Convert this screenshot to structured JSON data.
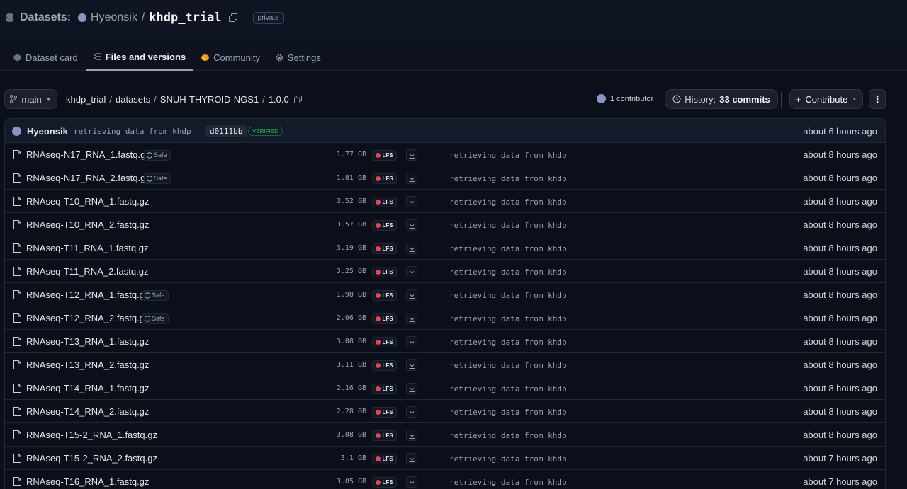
{
  "header": {
    "section_label": "Datasets:",
    "owner": "Hyeonsik",
    "separator": "/",
    "repo": "khdp_trial",
    "visibility": "private"
  },
  "tabs": [
    {
      "label": "Dataset card",
      "icon": "cube-icon"
    },
    {
      "label": "Files and versions",
      "icon": "files-icon",
      "active": true
    },
    {
      "label": "Community",
      "icon": "community-icon"
    },
    {
      "label": "Settings",
      "icon": "gear-icon"
    }
  ],
  "branch": {
    "name": "main",
    "path": [
      "khdp_trial",
      "datasets",
      "SNUH-THYROID-NGS1",
      "1.0.0"
    ],
    "path_sep": "/",
    "contributors": "1 contributor",
    "history_prefix": "History:",
    "history_count": "33 commits",
    "contribute_label": "Contribute",
    "more_label": "⋮"
  },
  "commit": {
    "author": "Hyeonsik",
    "message": "retrieving data from khdp",
    "hash": "d0111bb",
    "verified": "VERIFIED",
    "time": "about 6 hours ago"
  },
  "files": [
    {
      "name": "RNAseq-N17_RNA_1.fastq.gz",
      "safe": "Safe",
      "size": "1.77 GB",
      "lfs": "LFS",
      "message": "retrieving data from khdp",
      "time": "about 8 hours ago"
    },
    {
      "name": "RNAseq-N17_RNA_2.fastq.gz",
      "safe": "Safe",
      "size": "1.81 GB",
      "lfs": "LFS",
      "message": "retrieving data from khdp",
      "time": "about 8 hours ago"
    },
    {
      "name": "RNAseq-T10_RNA_1.fastq.gz",
      "safe": "",
      "size": "3.52 GB",
      "lfs": "LFS",
      "message": "retrieving data from khdp",
      "time": "about 8 hours ago"
    },
    {
      "name": "RNAseq-T10_RNA_2.fastq.gz",
      "safe": "",
      "size": "3.57 GB",
      "lfs": "LFS",
      "message": "retrieving data from khdp",
      "time": "about 8 hours ago"
    },
    {
      "name": "RNAseq-T11_RNA_1.fastq.gz",
      "safe": "",
      "size": "3.19 GB",
      "lfs": "LFS",
      "message": "retrieving data from khdp",
      "time": "about 8 hours ago"
    },
    {
      "name": "RNAseq-T11_RNA_2.fastq.gz",
      "safe": "",
      "size": "3.25 GB",
      "lfs": "LFS",
      "message": "retrieving data from khdp",
      "time": "about 8 hours ago"
    },
    {
      "name": "RNAseq-T12_RNA_1.fastq.gz",
      "safe": "Safe",
      "size": "1.98 GB",
      "lfs": "LFS",
      "message": "retrieving data from khdp",
      "time": "about 8 hours ago"
    },
    {
      "name": "RNAseq-T12_RNA_2.fastq.gz",
      "safe": "Safe",
      "size": "2.06 GB",
      "lfs": "LFS",
      "message": "retrieving data from khdp",
      "time": "about 8 hours ago"
    },
    {
      "name": "RNAseq-T13_RNA_1.fastq.gz",
      "safe": "",
      "size": "3.08 GB",
      "lfs": "LFS",
      "message": "retrieving data from khdp",
      "time": "about 8 hours ago"
    },
    {
      "name": "RNAseq-T13_RNA_2.fastq.gz",
      "safe": "",
      "size": "3.11 GB",
      "lfs": "LFS",
      "message": "retrieving data from khdp",
      "time": "about 8 hours ago"
    },
    {
      "name": "RNAseq-T14_RNA_1.fastq.gz",
      "safe": "",
      "size": "2.16 GB",
      "lfs": "LFS",
      "message": "retrieving data from khdp",
      "time": "about 8 hours ago"
    },
    {
      "name": "RNAseq-T14_RNA_2.fastq.gz",
      "safe": "",
      "size": "2.28 GB",
      "lfs": "LFS",
      "message": "retrieving data from khdp",
      "time": "about 8 hours ago"
    },
    {
      "name": "RNAseq-T15-2_RNA_1.fastq.gz",
      "safe": "",
      "size": "3.08 GB",
      "lfs": "LFS",
      "message": "retrieving data from khdp",
      "time": "about 8 hours ago"
    },
    {
      "name": "RNAseq-T15-2_RNA_2.fastq.gz",
      "safe": "",
      "size": "3.1 GB",
      "lfs": "LFS",
      "message": "retrieving data from khdp",
      "time": "about 7 hours ago"
    },
    {
      "name": "RNAseq-T16_RNA_1.fastq.gz",
      "safe": "",
      "size": "3.05 GB",
      "lfs": "LFS",
      "message": "retrieving data from khdp",
      "time": "about 7 hours ago"
    }
  ],
  "colors": {
    "background": "#0b0f19",
    "accent_lfs": "#ef4444",
    "verified": "#22c55e",
    "avatar": "#8b93c7"
  }
}
